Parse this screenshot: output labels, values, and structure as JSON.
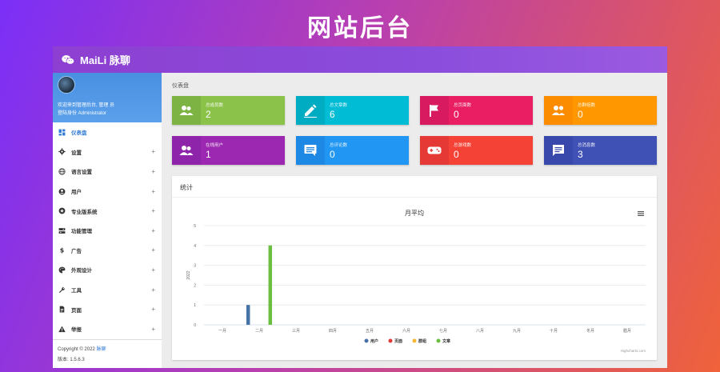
{
  "hero_title": "网站后台",
  "app": {
    "brand": "MaiLi 脉聊",
    "brand_color": "#8a4ddc"
  },
  "profile": {
    "welcome": "欢迎来到管理后台, 管理 员",
    "role": "登陆身份 Administrator"
  },
  "nav": [
    {
      "label": "仪表盘",
      "icon": "dashboard-icon",
      "active": true,
      "expandable": false
    },
    {
      "label": "设置",
      "icon": "gear-icon",
      "active": false,
      "expandable": true
    },
    {
      "label": "语言设置",
      "icon": "globe-icon",
      "active": false,
      "expandable": true
    },
    {
      "label": "用户",
      "icon": "user-circle-icon",
      "active": false,
      "expandable": true
    },
    {
      "label": "专业版系统",
      "icon": "star-icon",
      "active": false,
      "expandable": true
    },
    {
      "label": "功能管理",
      "icon": "toggle-icon",
      "active": false,
      "expandable": true
    },
    {
      "label": "广告",
      "icon": "dollar-icon",
      "active": false,
      "expandable": true
    },
    {
      "label": "外观设计",
      "icon": "palette-icon",
      "active": false,
      "expandable": true
    },
    {
      "label": "工具",
      "icon": "wrench-icon",
      "active": false,
      "expandable": true
    },
    {
      "label": "页面",
      "icon": "file-icon",
      "active": false,
      "expandable": true
    },
    {
      "label": "举报",
      "icon": "warning-icon",
      "active": false,
      "expandable": true
    }
  ],
  "footer": {
    "copyright": "Copyright © 2022",
    "copyright_link": "脉聊",
    "version": "版本: 1.5.6.3"
  },
  "breadcrumb": "仪表盘",
  "stats": [
    {
      "label": "总成员数",
      "value": "2",
      "icon": "users-icon",
      "color": "#8bc34a",
      "icon_bg": "#7cb342"
    },
    {
      "label": "总文章数",
      "value": "6",
      "icon": "pencil-icon",
      "color": "#00bcd4",
      "icon_bg": "#00acc1"
    },
    {
      "label": "总页面数",
      "value": "0",
      "icon": "flag-icon",
      "color": "#e91e63",
      "icon_bg": "#d81b60"
    },
    {
      "label": "总群组数",
      "value": "0",
      "icon": "group-icon",
      "color": "#ff9800",
      "icon_bg": "#fb8c00"
    },
    {
      "label": "在线用户",
      "value": "1",
      "icon": "users-icon",
      "color": "#9c27b0",
      "icon_bg": "#8e24aa"
    },
    {
      "label": "总评论数",
      "value": "0",
      "icon": "comment-icon",
      "color": "#2196f3",
      "icon_bg": "#1e88e5"
    },
    {
      "label": "总游戏数",
      "value": "0",
      "icon": "gamepad-icon",
      "color": "#f44336",
      "icon_bg": "#e53935"
    },
    {
      "label": "总消息数",
      "value": "3",
      "icon": "message-icon",
      "color": "#3f51b5",
      "icon_bg": "#3949ab"
    }
  ],
  "panel": {
    "title": "统计",
    "credits": "Highcharts.com"
  },
  "chart_data": {
    "type": "bar",
    "title": "月平均",
    "xlabel": "",
    "ylabel": "2022",
    "ylim": [
      0,
      5
    ],
    "yticks": [
      0,
      1,
      2,
      3,
      4,
      5
    ],
    "categories": [
      "一月",
      "二月",
      "三月",
      "四月",
      "五月",
      "六月",
      "七月",
      "八月",
      "九月",
      "十月",
      "冬月",
      "腊月"
    ],
    "series": [
      {
        "name": "用户",
        "color": "#4572a7",
        "values": [
          0,
          1,
          0,
          0,
          0,
          0,
          0,
          0,
          0,
          0,
          0,
          0
        ]
      },
      {
        "name": "页面",
        "color": "#e53935",
        "values": [
          0,
          0,
          0,
          0,
          0,
          0,
          0,
          0,
          0,
          0,
          0,
          0
        ]
      },
      {
        "name": "群组",
        "color": "#f5b82e",
        "values": [
          0,
          0,
          0,
          0,
          0,
          0,
          0,
          0,
          0,
          0,
          0,
          0
        ]
      },
      {
        "name": "文章",
        "color": "#6abf40",
        "values": [
          0,
          4,
          0,
          0,
          0,
          0,
          0,
          0,
          0,
          0,
          0,
          0
        ]
      }
    ],
    "grid": true,
    "legend": "bottom"
  }
}
